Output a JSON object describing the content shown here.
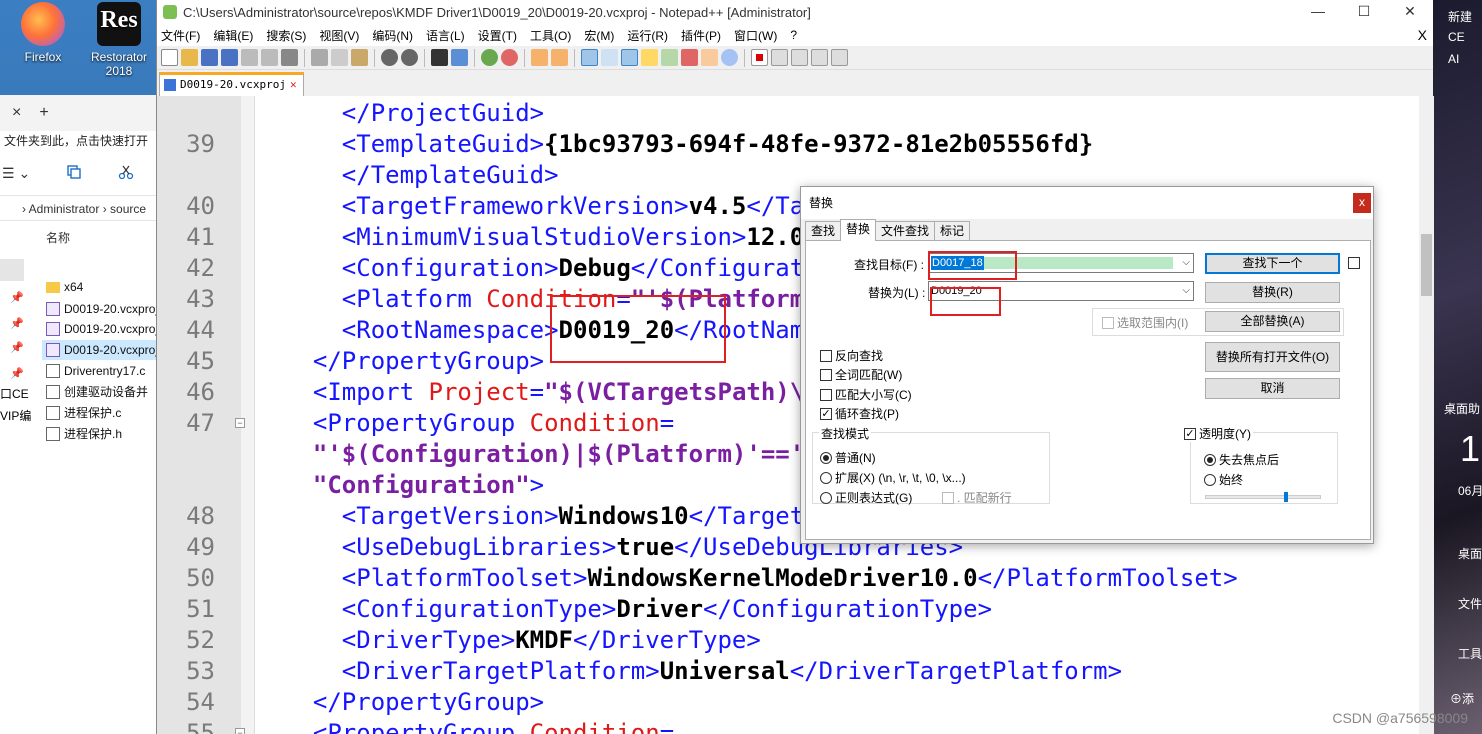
{
  "desktop": {
    "icons": [
      {
        "label": "Firefox"
      },
      {
        "label": "Restorator 2018"
      }
    ],
    "wallpaper_items": [
      "新建",
      "CE",
      "AI",
      "桌面助",
      "1",
      "06月",
      "桌面",
      "文件",
      "工具",
      "⊕添"
    ]
  },
  "explorer": {
    "tab_close": "×",
    "tab_add": "+",
    "quick_access_hint": "文件夹到此，点击快速打开",
    "toolbar_view": "☰ ⌄",
    "path": "› Administrator › source",
    "column_name": "名称",
    "left_labels": [
      "口CE",
      "VIP编"
    ],
    "files": [
      {
        "name": "x64",
        "icon": "folder-icon"
      },
      {
        "name": "D0019-20.vcxproj",
        "icon": "vcxproj-icon"
      },
      {
        "name": "D0019-20.vcxproj",
        "icon": "vcxproj-icon"
      },
      {
        "name": "D0019-20.vcxproj",
        "icon": "vcxproj-icon"
      },
      {
        "name": "Driverentry17.c",
        "icon": "c-file-icon"
      },
      {
        "name": "创建驱动设备并",
        "icon": "c-file-icon"
      },
      {
        "name": "进程保护.c",
        "icon": "c-file-icon"
      },
      {
        "name": "进程保护.h",
        "icon": "h-file-icon"
      }
    ]
  },
  "npp": {
    "title": "C:\\Users\\Administrator\\source\\repos\\KMDF Driver1\\D0019_20\\D0019-20.vcxproj - Notepad++ [Administrator]",
    "window_controls": [
      "—",
      "☐",
      "✕"
    ],
    "menus": [
      "文件(F)",
      "编辑(E)",
      "搜索(S)",
      "视图(V)",
      "编码(N)",
      "语言(L)",
      "设置(T)",
      "工具(O)",
      "宏(M)",
      "运行(R)",
      "插件(P)",
      "窗口(W)",
      "?"
    ],
    "menu_close": "X",
    "tab_label": "D0019-20.vcxproj",
    "tab_close": "✕"
  },
  "editor": {
    "lines": [
      {
        "no": "",
        "parts": [
          {
            "t": "    </ProjectGuid>",
            "c": "tag"
          }
        ]
      },
      {
        "no": "39",
        "parts": [
          {
            "t": "    <TemplateGuid>",
            "c": "tag"
          },
          {
            "t": "{1bc93793-694f-48fe-9372-81e2b05556fd}",
            "c": "txt"
          }
        ]
      },
      {
        "no": "",
        "parts": [
          {
            "t": "    </TemplateGuid>",
            "c": "tag"
          }
        ]
      },
      {
        "no": "40",
        "parts": [
          {
            "t": "    <TargetFrameworkVersion>",
            "c": "tag"
          },
          {
            "t": "v4.5",
            "c": "txt"
          },
          {
            "t": "</TargetFrameworkVersion>",
            "c": "tag"
          }
        ]
      },
      {
        "no": "41",
        "parts": [
          {
            "t": "    <MinimumVisualStudioVersion>",
            "c": "tag"
          },
          {
            "t": "12.0",
            "c": "txt"
          },
          {
            "t": "</MinimumVisualStudioVersion>",
            "c": "tag"
          }
        ]
      },
      {
        "no": "42",
        "parts": [
          {
            "t": "    <Configuration>",
            "c": "tag"
          },
          {
            "t": "Debug",
            "c": "txt"
          },
          {
            "t": "</Configuration>",
            "c": "tag"
          }
        ]
      },
      {
        "no": "43",
        "parts": [
          {
            "t": "    <Platform ",
            "c": "tag"
          },
          {
            "t": "Condition",
            "c": "attr"
          },
          {
            "t": "=",
            "c": "tag"
          },
          {
            "t": "\"'$(Platform)'==''\"",
            "c": "val"
          },
          {
            "t": ">",
            "c": "tag"
          }
        ]
      },
      {
        "no": "44",
        "parts": [
          {
            "t": "    <RootNamespace>",
            "c": "tag"
          },
          {
            "t": "D0019_20",
            "c": "txt"
          },
          {
            "t": "</RootNamespace>",
            "c": "tag"
          }
        ]
      },
      {
        "no": "45",
        "parts": [
          {
            "t": "  </PropertyGroup>",
            "c": "tag"
          }
        ]
      },
      {
        "no": "46",
        "parts": [
          {
            "t": "  <Import ",
            "c": "tag"
          },
          {
            "t": "Project",
            "c": "attr"
          },
          {
            "t": "=",
            "c": "tag"
          },
          {
            "t": "\"$(VCTargetsPath)\\Microsoft.Cpp.Default.props\"",
            "c": "val"
          },
          {
            "t": " />",
            "c": "tag"
          }
        ]
      },
      {
        "no": "47",
        "parts": [
          {
            "t": "  <PropertyGroup ",
            "c": "tag"
          },
          {
            "t": "Condition",
            "c": "attr"
          },
          {
            "t": "=",
            "c": "tag"
          }
        ]
      },
      {
        "no": "",
        "parts": [
          {
            "t": "  \"'$(Configuration)|$(Platform)'=='Debug|x64'\" ",
            "c": "val"
          },
          {
            "t": "Label",
            "c": "attr"
          },
          {
            "t": "=",
            "c": "tag"
          }
        ]
      },
      {
        "no": "",
        "parts": [
          {
            "t": "  \"Configuration\"",
            "c": "val"
          },
          {
            "t": ">",
            "c": "tag"
          }
        ]
      },
      {
        "no": "48",
        "parts": [
          {
            "t": "    <TargetVersion>",
            "c": "tag"
          },
          {
            "t": "Windows10",
            "c": "txt"
          },
          {
            "t": "</TargetVersion>",
            "c": "tag"
          }
        ]
      },
      {
        "no": "49",
        "parts": [
          {
            "t": "    <UseDebugLibraries>",
            "c": "tag"
          },
          {
            "t": "true",
            "c": "txt"
          },
          {
            "t": "</UseDebugLibraries>",
            "c": "tag"
          }
        ]
      },
      {
        "no": "50",
        "parts": [
          {
            "t": "    <PlatformToolset>",
            "c": "tag"
          },
          {
            "t": "WindowsKernelModeDriver10.0",
            "c": "txt"
          },
          {
            "t": "</PlatformToolset>",
            "c": "tag"
          }
        ]
      },
      {
        "no": "51",
        "parts": [
          {
            "t": "    <ConfigurationType>",
            "c": "tag"
          },
          {
            "t": "Driver",
            "c": "txt"
          },
          {
            "t": "</ConfigurationType>",
            "c": "tag"
          }
        ]
      },
      {
        "no": "52",
        "parts": [
          {
            "t": "    <DriverType>",
            "c": "tag"
          },
          {
            "t": "KMDF",
            "c": "txt"
          },
          {
            "t": "</DriverType>",
            "c": "tag"
          }
        ]
      },
      {
        "no": "53",
        "parts": [
          {
            "t": "    <DriverTargetPlatform>",
            "c": "tag"
          },
          {
            "t": "Universal",
            "c": "txt"
          },
          {
            "t": "</DriverTargetPlatform>",
            "c": "tag"
          }
        ]
      },
      {
        "no": "54",
        "parts": [
          {
            "t": "  </PropertyGroup>",
            "c": "tag"
          }
        ]
      },
      {
        "no": "55",
        "parts": [
          {
            "t": "  <PropertyGroup ",
            "c": "tag"
          },
          {
            "t": "Condition",
            "c": "attr"
          },
          {
            "t": "=",
            "c": "tag"
          }
        ]
      }
    ]
  },
  "dialog": {
    "title": "替换",
    "close": "x",
    "tabs": [
      "查找",
      "替换",
      "文件查找",
      "标记"
    ],
    "find_label": "查找目标(F) :",
    "find_value": "D0017_18",
    "replace_label": "替换为(L) :",
    "replace_value": "D0019_20",
    "in_selection": "选取范围内(I)",
    "buttons": {
      "find_next": "查找下一个",
      "replace": "替换(R)",
      "replace_all": "全部替换(A)",
      "replace_all_open": "替换所有打开文件(O)",
      "cancel": "取消"
    },
    "options": [
      {
        "label": "反向查找",
        "checked": false
      },
      {
        "label": "全词匹配(W)",
        "checked": false
      },
      {
        "label": "匹配大小写(C)",
        "checked": false
      },
      {
        "label": "循环查找(P)",
        "checked": true
      }
    ],
    "search_mode": {
      "title": "查找模式",
      "normal": "普通(N)",
      "extended": "扩展(X) (\\n, \\r, \\t, \\0, \\x...)",
      "regex": "正则表达式(G)",
      "dot_newline": ". 匹配新行",
      "selected": "normal"
    },
    "transparency": {
      "label": "透明度(Y)",
      "checked": true,
      "on_lose_focus": "失去焦点后",
      "always": "始终",
      "selected": "on_lose_focus",
      "level": 0.7
    }
  },
  "watermark": "CSDN @a756598009"
}
